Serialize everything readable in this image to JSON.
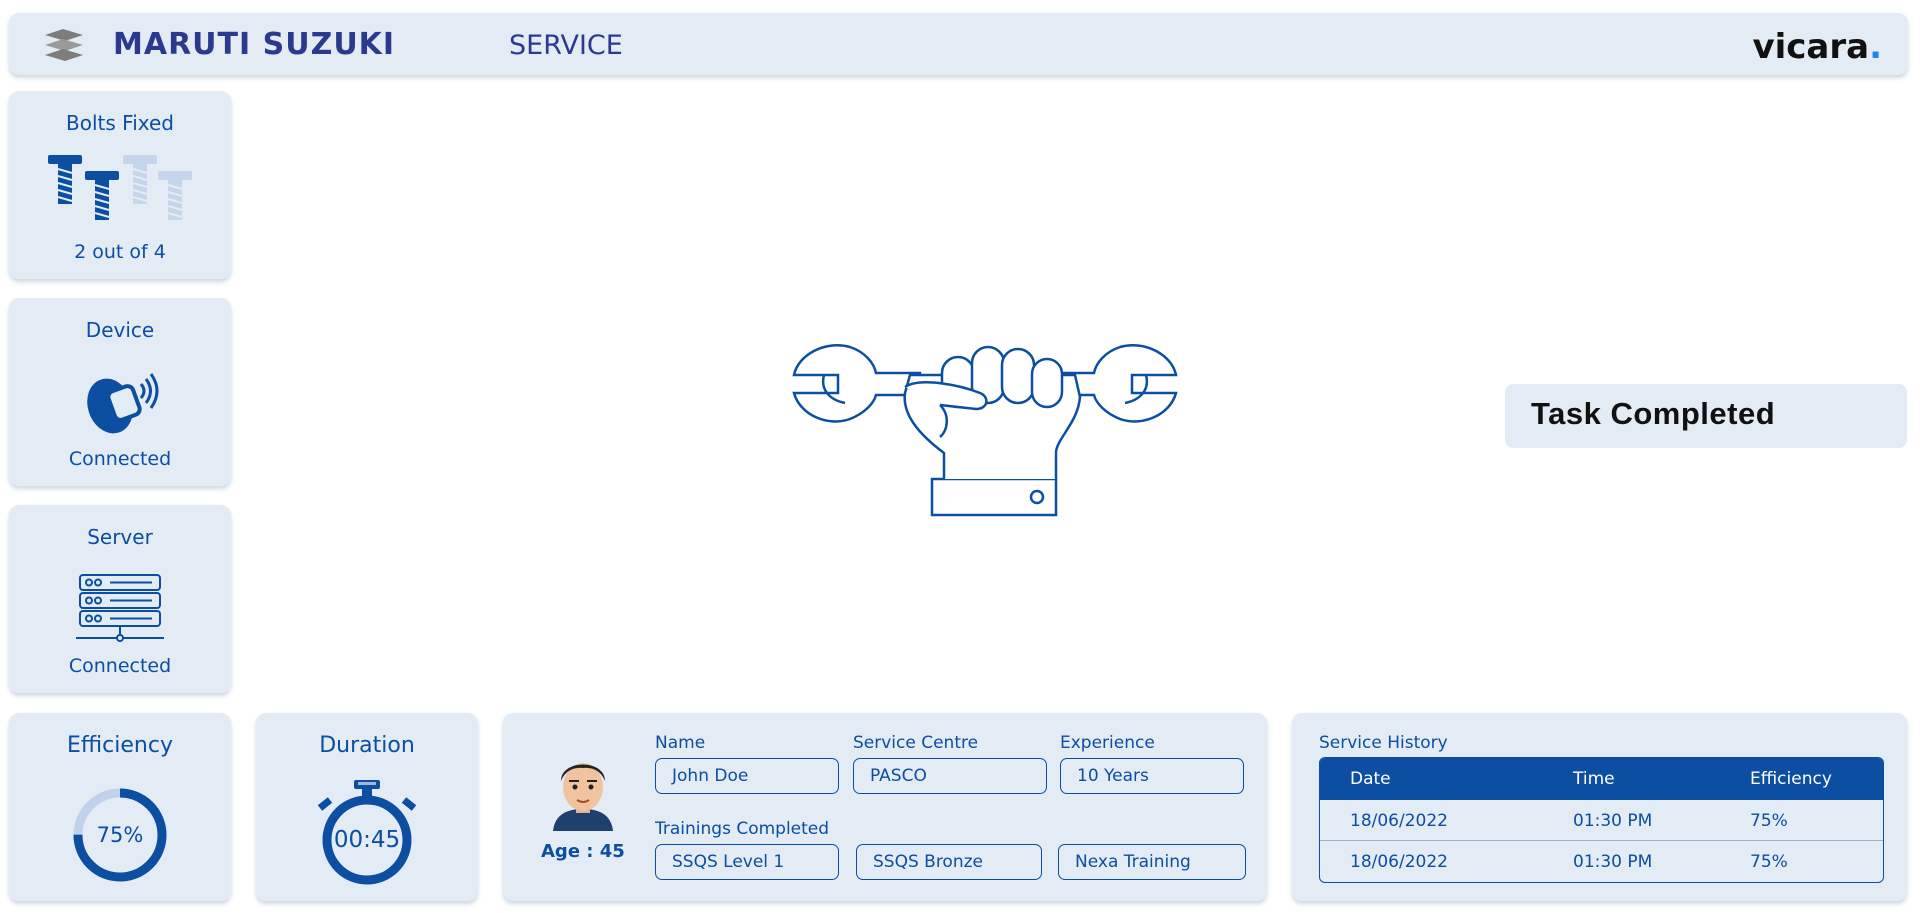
{
  "header": {
    "brand_name": "MARUTI SUZUKI",
    "brand_service": "SERVICE",
    "partner_logo": "vicara",
    "partner_logo_dot": "."
  },
  "status_cards": {
    "bolts": {
      "title": "Bolts Fixed",
      "status": "2 out of 4",
      "fixed": 2,
      "total": 4
    },
    "device": {
      "title": "Device",
      "status": "Connected",
      "icon": "smartwatch-icon"
    },
    "server": {
      "title": "Server",
      "status": "Connected",
      "icon": "server-icon"
    }
  },
  "task": {
    "status": "Task Completed",
    "icon": "hand-wrench-icon"
  },
  "efficiency": {
    "title": "Efficiency",
    "value": "75%",
    "fraction": 0.75
  },
  "duration": {
    "title": "Duration",
    "value": "00:45"
  },
  "profile": {
    "age_label": "Age : 45",
    "name_label": "Name",
    "name_value": "John Doe",
    "centre_label": "Service Centre",
    "centre_value": "PASCO",
    "experience_label": "Experience",
    "experience_value": "10 Years",
    "trainings_label": "Trainings Completed",
    "trainings": [
      "SSQS Level 1",
      "SSQS Bronze",
      "Nexa Training"
    ]
  },
  "history": {
    "title": "Service History",
    "columns": [
      "Date",
      "Time",
      "Efficiency"
    ],
    "rows": [
      [
        "18/06/2022",
        "01:30 PM",
        "75%"
      ],
      [
        "18/06/2022",
        "01:30 PM",
        "75%"
      ]
    ]
  },
  "colors": {
    "primary": "#0b4ea2",
    "card_bg": "#e3ebf5",
    "brand": "#2b3a8f",
    "accent_dot": "#1e88e5"
  }
}
